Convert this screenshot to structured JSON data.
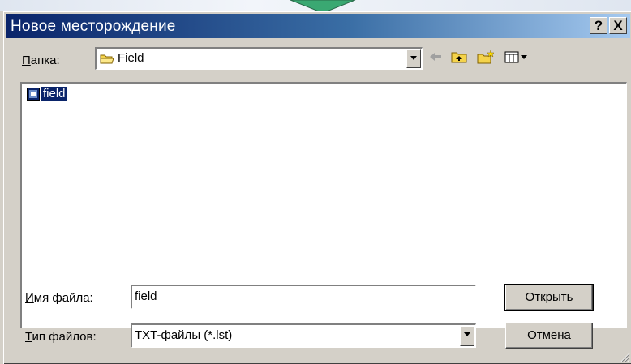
{
  "window": {
    "title": "Новое месторождение",
    "help_button": "?",
    "close_button": "X"
  },
  "folder": {
    "label": "Папка:",
    "label_accel": "П",
    "label_rest": "апка:",
    "value": "Field"
  },
  "toolbar": {
    "icons": [
      "back-arrow-icon",
      "up-folder-icon",
      "new-folder-icon",
      "view-menu-icon"
    ]
  },
  "files": [
    {
      "name": "field",
      "icon": "file-icon",
      "selected": true
    }
  ],
  "filename": {
    "label": "Имя файла:",
    "label_accel": "И",
    "label_rest": "мя файла:",
    "value": "field"
  },
  "filetype": {
    "label": "Тип файлов:",
    "label_accel": "Т",
    "label_rest": "ип файлов:",
    "value": "TXT-файлы (*.lst)"
  },
  "buttons": {
    "open": "Открыть",
    "open_accel": "О",
    "open_rest": "ткрыть",
    "cancel": "Отмена"
  },
  "colors": {
    "title_start": "#0a246a",
    "title_end": "#a6caf0",
    "face": "#d4d0c8",
    "selection": "#0a246a"
  }
}
